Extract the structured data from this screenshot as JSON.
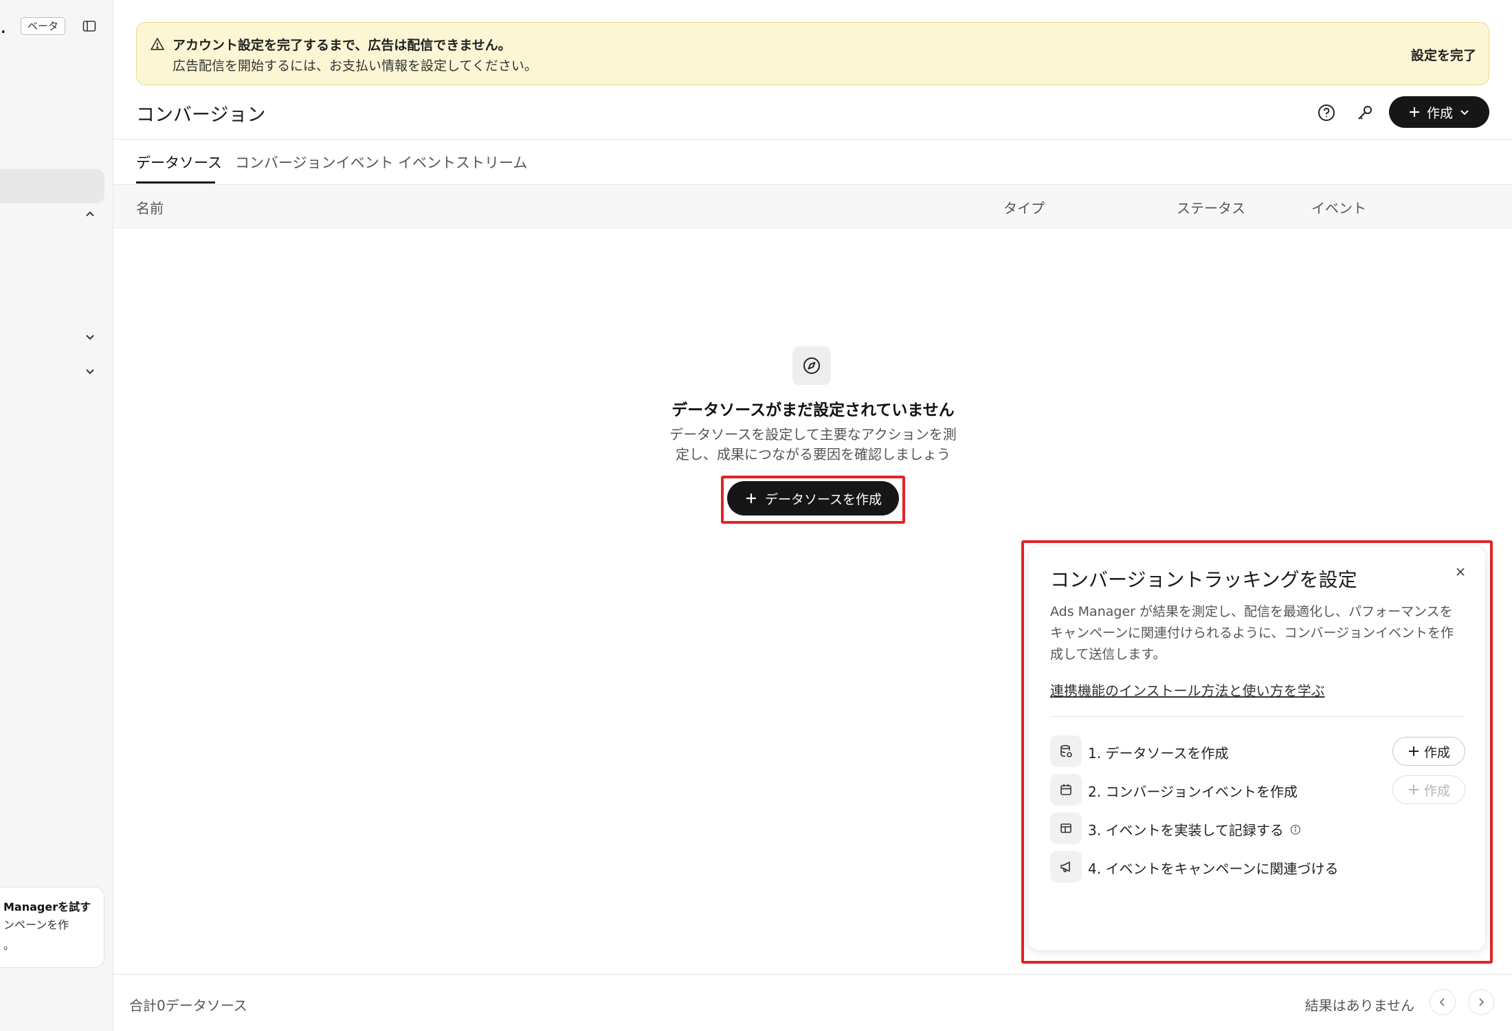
{
  "sidebar": {
    "beta_badge": "ベータ",
    "promo": {
      "title": "Managerを試す",
      "text": "ンペーンを作\n。"
    }
  },
  "banner": {
    "title": "アカウント設定を完了するまで、広告は配信できません。",
    "subtitle": "広告配信を開始するには、お支払い情報を設定してください。",
    "action": "設定を完了"
  },
  "header": {
    "title": "コンバージョン",
    "create_label": "作成"
  },
  "tabs": [
    {
      "label": "データソース",
      "active": true
    },
    {
      "label": "コンバージョンイベント",
      "active": false
    },
    {
      "label": "イベントストリーム",
      "active": false
    }
  ],
  "table": {
    "columns": [
      "名前",
      "タイプ",
      "ステータス",
      "イベント"
    ]
  },
  "empty_state": {
    "title": "データソースがまだ設定されていません",
    "description": "データソースを設定して主要なアクションを測定し、成果につながる要因を確認しましょう",
    "button": "データソースを作成"
  },
  "tracking_panel": {
    "title": "コンバージョントラッキングを設定",
    "description": "Ads Manager が結果を測定し、配信を最適化し、パフォーマンスをキャンペーンに関連付けられるように、コンバージョンイベントを作成して送信します。",
    "link": "連携機能のインストール方法と使い方を学ぶ",
    "steps": [
      {
        "label": "1. データソースを作成",
        "button": "作成",
        "icon": "database-icon"
      },
      {
        "label": "2. コンバージョンイベントを作成",
        "button": "作成",
        "icon": "calendar-icon"
      },
      {
        "label": "3. イベントを実装して記録する",
        "icon": "layout-icon"
      },
      {
        "label": "4. イベントをキャンペーンに関連づける",
        "icon": "megaphone-icon"
      }
    ]
  },
  "footer": {
    "count": "合計0データソース",
    "result": "結果はありません"
  }
}
